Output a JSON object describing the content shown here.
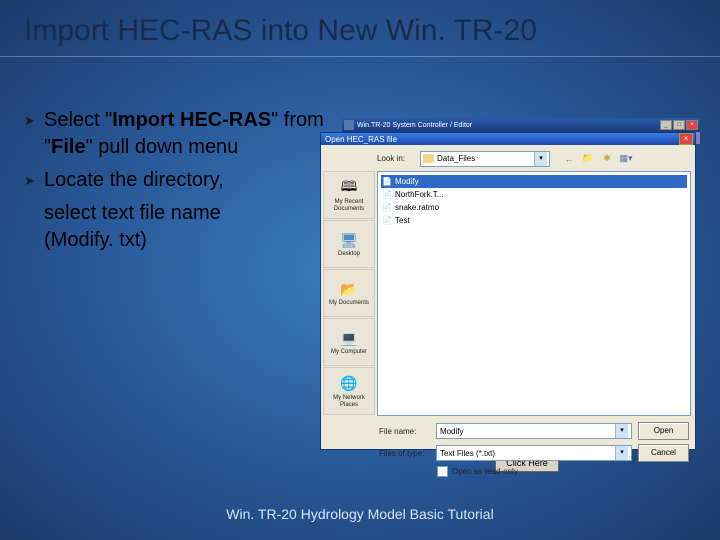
{
  "title": "Import HEC-RAS into New Win. TR-20",
  "bullets": {
    "b1_pre": "Select \"",
    "b1_strong": "Import HEC-RAS",
    "b1_mid": "\" from \"",
    "b1_strong2": "File",
    "b1_post": "\" pull down menu",
    "b2": "Locate the directory,",
    "b2_cont1": "select text file name",
    "b2_cont2": "(Modify. txt)"
  },
  "parent_window": {
    "title": "Win.TR-20 System Controller / Editor",
    "click": "Click Here"
  },
  "dialog": {
    "title": "Open HEC_RAS file",
    "lookin_label": "Look in:",
    "lookin_value": "Data_Files",
    "places": [
      "My Recent Documents",
      "Desktop",
      "My Documents",
      "My Computer",
      "My Network Places"
    ],
    "files": [
      {
        "name": "Modify",
        "selected": true
      },
      {
        "name": "NorthFork.T...",
        "selected": false
      },
      {
        "name": "snake.ratmo",
        "selected": false
      },
      {
        "name": "Test",
        "selected": false
      }
    ],
    "filename_label": "File name:",
    "filename_value": "Modify",
    "filetype_label": "Files of type:",
    "filetype_value": "Text Files (*.txt)",
    "open": "Open",
    "cancel": "Cancel",
    "readonly": "Open as read-only"
  },
  "footer": "Win. TR-20 Hydrology Model Basic Tutorial"
}
